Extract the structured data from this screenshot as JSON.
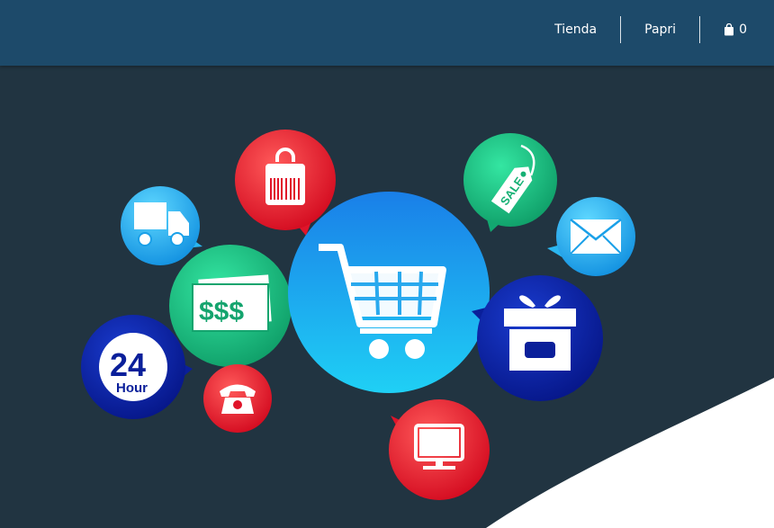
{
  "nav": {
    "items": [
      {
        "label": "Tienda"
      },
      {
        "label": "Papri"
      }
    ],
    "cart": {
      "icon": "shopping-bag-icon",
      "count": "0"
    }
  },
  "hero": {
    "image": "e-commerce-icons-illustration",
    "icons": [
      "shopping-cart-icon",
      "shopping-bag-barcode-icon",
      "delivery-truck-icon",
      "sale-tag-icon",
      "mail-icon",
      "money-icon",
      "gift-box-icon",
      "24-hour-icon",
      "telephone-icon",
      "monitor-icon"
    ],
    "badge_24": {
      "number": "24",
      "unit": "Hour"
    },
    "money_text": "$$$",
    "sale_text": "SALE"
  },
  "colors": {
    "topbar": "#1d4a6a",
    "background": "#213441",
    "red": "#e8192c",
    "green": "#18b97c",
    "cyan": "#1fa8e8",
    "navy": "#0a1f9a",
    "white": "#ffffff"
  }
}
